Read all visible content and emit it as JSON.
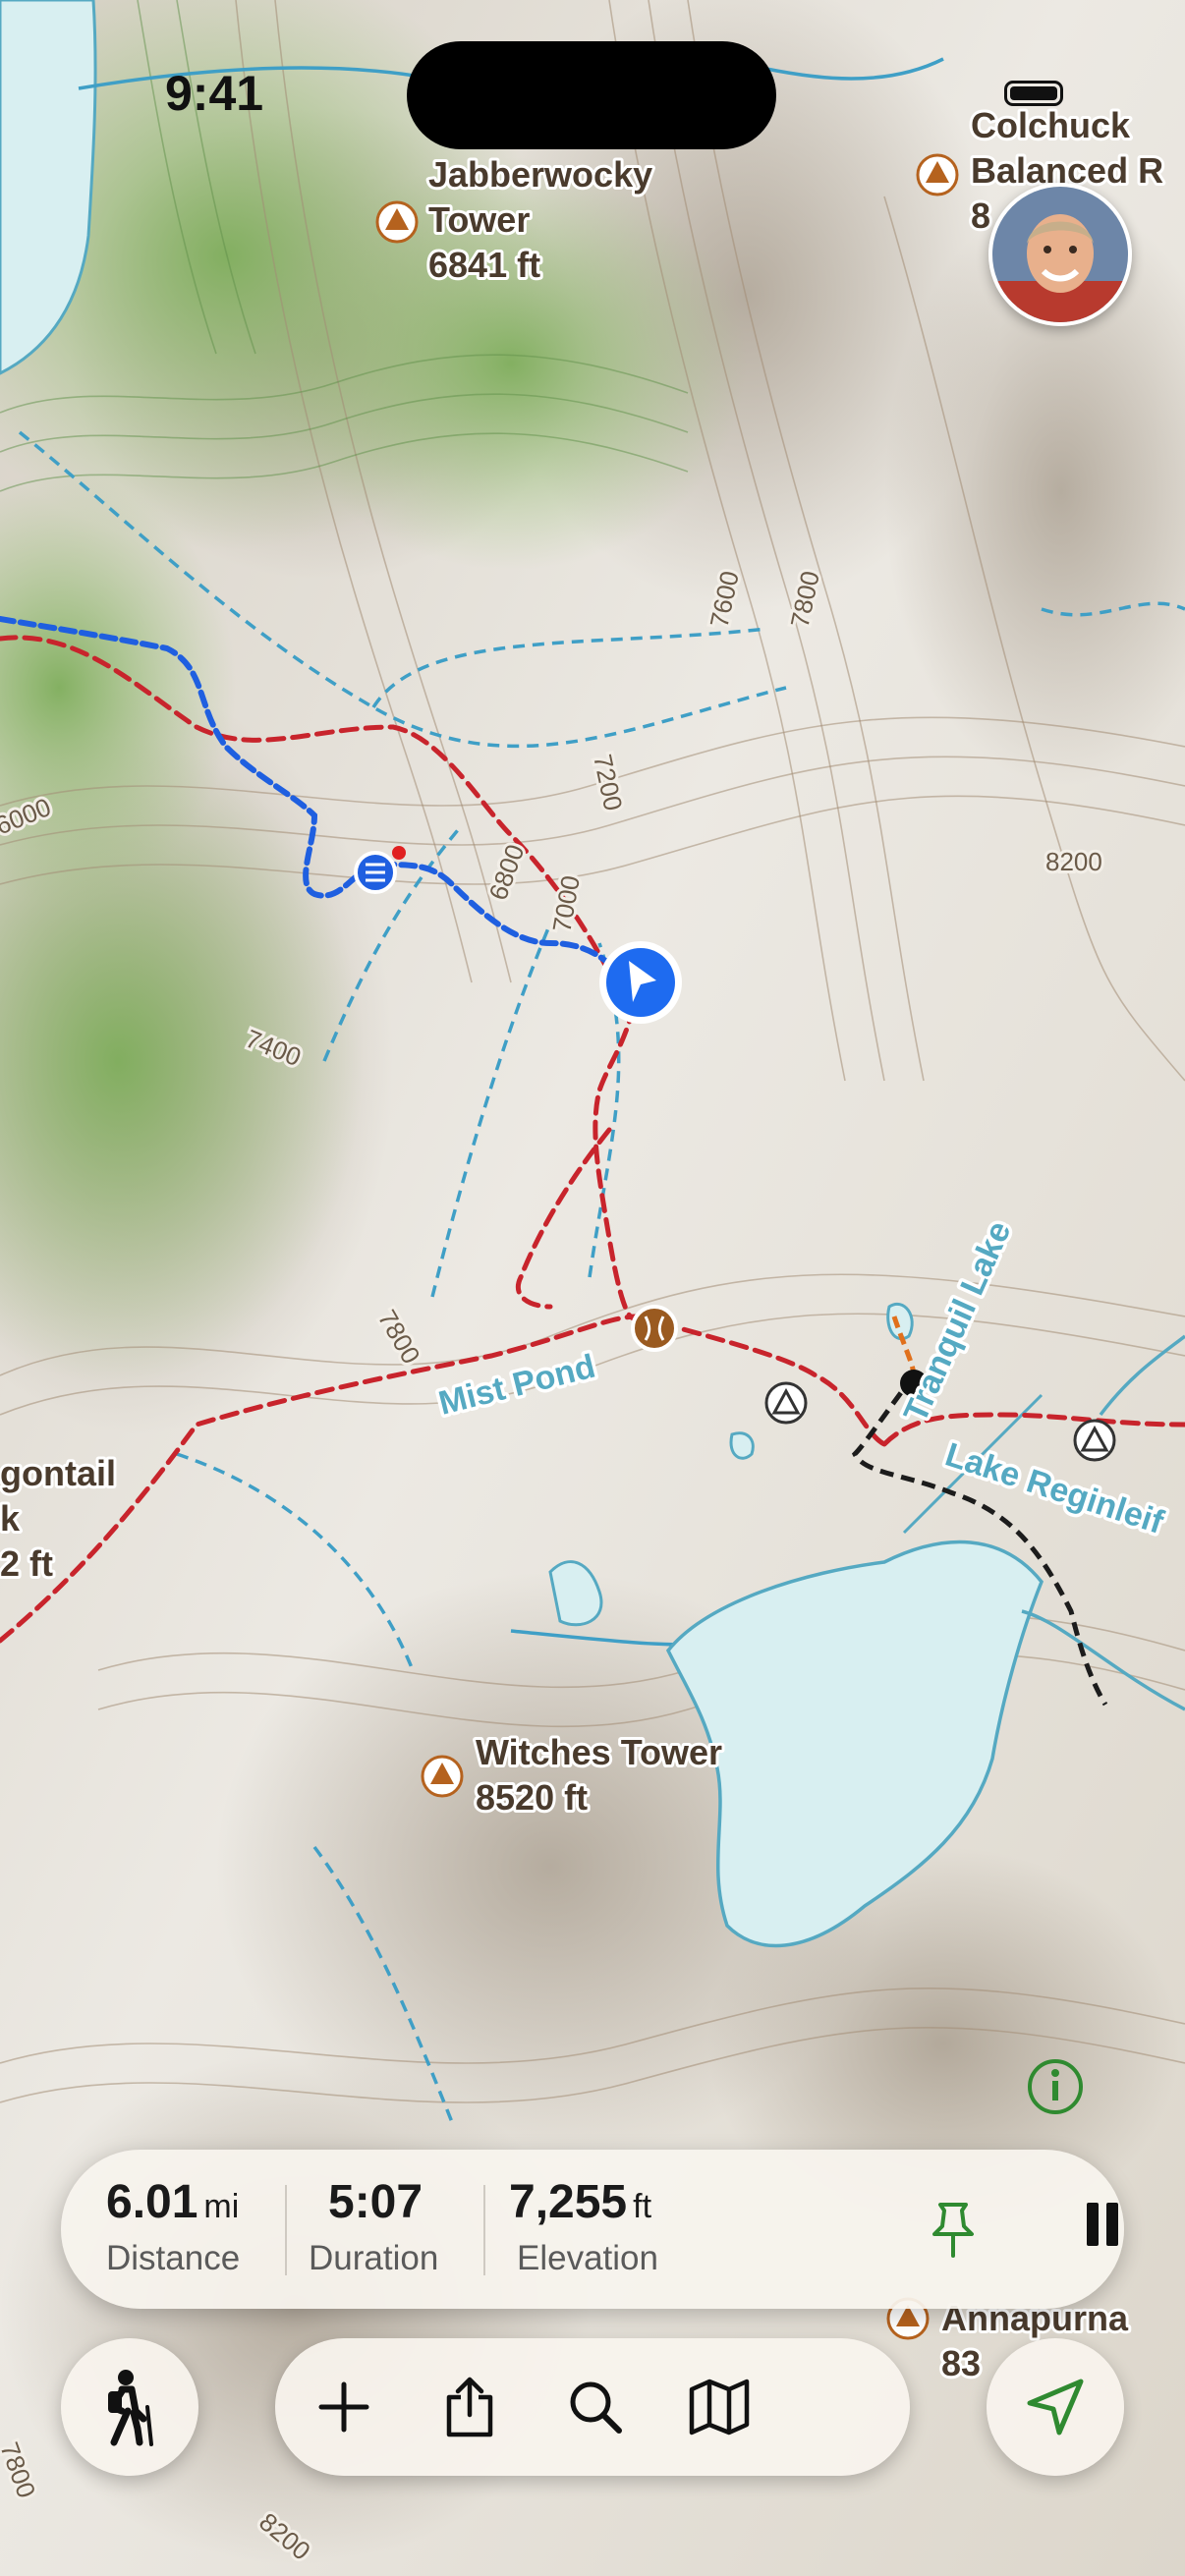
{
  "status_bar": {
    "time": "9:41"
  },
  "map": {
    "peaks": [
      {
        "name": "Jabberwocky",
        "name2": "Tower",
        "elevation": "6841 ft"
      },
      {
        "name": "Colchuck",
        "name2": "Balanced R",
        "elevation": "8"
      },
      {
        "name": "Witches Tower",
        "elevation": "8520 ft"
      },
      {
        "name": "Annapurna",
        "elevation": "83"
      },
      {
        "name": "gontail",
        "name2": "k",
        "elevation": "2 ft"
      }
    ],
    "water": {
      "mist_pond": "Mist Pond",
      "tranquil_lake": "Tranquil Lake",
      "lake_reginleif": "Lake Reginleif"
    },
    "contours": [
      "7600",
      "7800",
      "8200",
      "6000",
      "7200",
      "6800",
      "7000",
      "7400",
      "7800",
      "8200",
      "7800"
    ],
    "colors": {
      "route_red": "#c8242c",
      "recorded_track_blue": "#1f5fe0",
      "stream_blue": "#3f9fc6",
      "lake_fill": "#d8eff1",
      "forest_green": "#8fb86a",
      "location_marker": "#1e6bf0"
    },
    "icons": [
      "peak-icon",
      "campsite-icon",
      "trailhead-icon",
      "info-icon",
      "location-arrow-icon"
    ]
  },
  "stats": {
    "distance": {
      "value": "6.01",
      "unit": "mi",
      "label": "Distance"
    },
    "duration": {
      "value": "5:07",
      "label": "Duration"
    },
    "elevation": {
      "value": "7,255",
      "unit": "ft",
      "label": "Elevation"
    }
  },
  "toolbar": [
    "activity-hiker-icon",
    "add-icon",
    "share-icon",
    "search-icon",
    "map-layers-icon",
    "locate-icon"
  ]
}
